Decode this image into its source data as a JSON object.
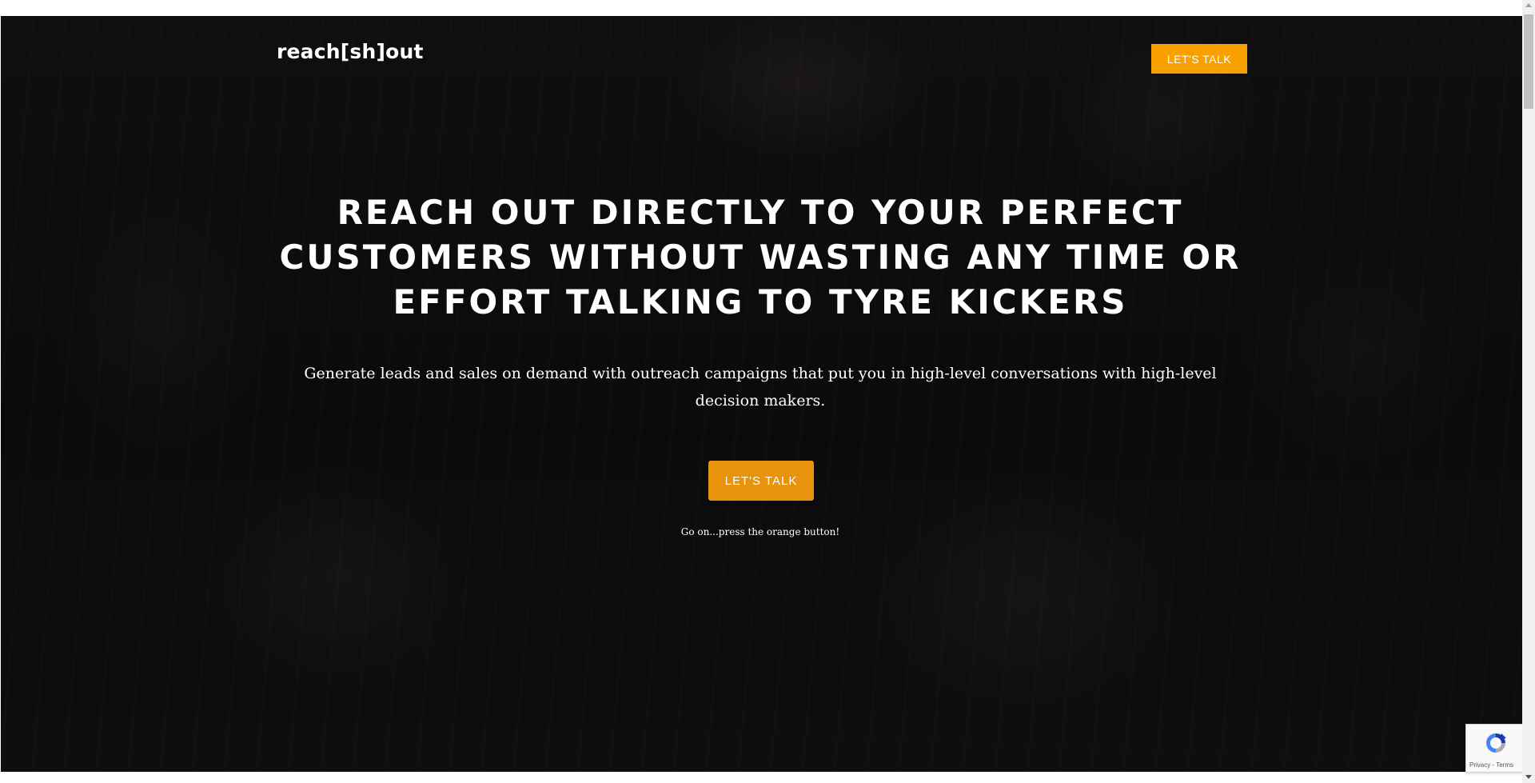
{
  "header": {
    "logo": "reach[sh]out",
    "cta_label": "LET'S TALK"
  },
  "hero": {
    "headline": "REACH OUT DIRECTLY TO YOUR PERFECT CUSTOMERS WITHOUT WASTING ANY TIME OR EFFORT TALKING TO TYRE KICKERS",
    "subheadline": "Generate leads and sales on demand with outreach campaigns that put you in high-level conversations with high-level decision makers.",
    "cta_label": "LET'S TALK",
    "cta_note": "Go on...press the orange button!"
  },
  "recaptcha": {
    "privacy_label": "Privacy",
    "separator": " - ",
    "terms_label": "Terms"
  },
  "colors": {
    "accent": "#f9a001",
    "hero_background": "#0b0a0c",
    "text": "#ffffff"
  },
  "icons": {
    "recaptcha": "recaptcha-icon"
  }
}
